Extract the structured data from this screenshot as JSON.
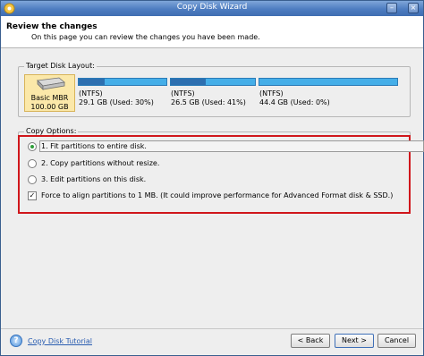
{
  "window": {
    "title": "Copy Disk Wizard"
  },
  "header": {
    "title": "Review the changes",
    "subtitle": "On this page you can review the changes you have been made."
  },
  "target_disk": {
    "group_label": "Target Disk Layout:",
    "disk": {
      "type": "Basic MBR",
      "size": "100.00 GB"
    },
    "partitions": [
      {
        "fs": "(NTFS)",
        "info": "29.1 GB (Used: 30%)",
        "used_fraction": 0.3
      },
      {
        "fs": "(NTFS)",
        "info": "26.5 GB (Used: 41%)",
        "used_fraction": 0.41
      },
      {
        "fs": "(NTFS)",
        "info": "44.4 GB (Used: 0%)",
        "used_fraction": 0.0
      }
    ]
  },
  "copy_options": {
    "group_label": "Copy Options:",
    "options": [
      {
        "label": "1. Fit partitions to entire disk.",
        "selected": true
      },
      {
        "label": "2. Copy partitions without resize.",
        "selected": false
      },
      {
        "label": "3. Edit partitions on this disk.",
        "selected": false
      }
    ],
    "align": {
      "label": "Force to align partitions to 1 MB.  (It could improve performance for Advanced Format disk & SSD.)",
      "checked": true
    }
  },
  "footer": {
    "help_link": "Copy Disk Tutorial",
    "back_label": "< Back",
    "next_label": "Next >",
    "cancel_label": "Cancel"
  },
  "icons": {
    "app": "app-logo-icon",
    "minimize": "minimize-icon",
    "close": "close-icon",
    "disk": "hard-disk-icon",
    "help": "help-icon",
    "back_arrow": "arrow-left-icon",
    "next_arrow": "arrow-right-icon",
    "cancel": "cancel-icon"
  },
  "colors": {
    "titlebar": "#4d7cc0",
    "partition_bar": "#45aee8",
    "partition_used": "#2d6fb0",
    "highlight_frame": "#d0161b",
    "selected_disk": "#fbe8a9"
  }
}
